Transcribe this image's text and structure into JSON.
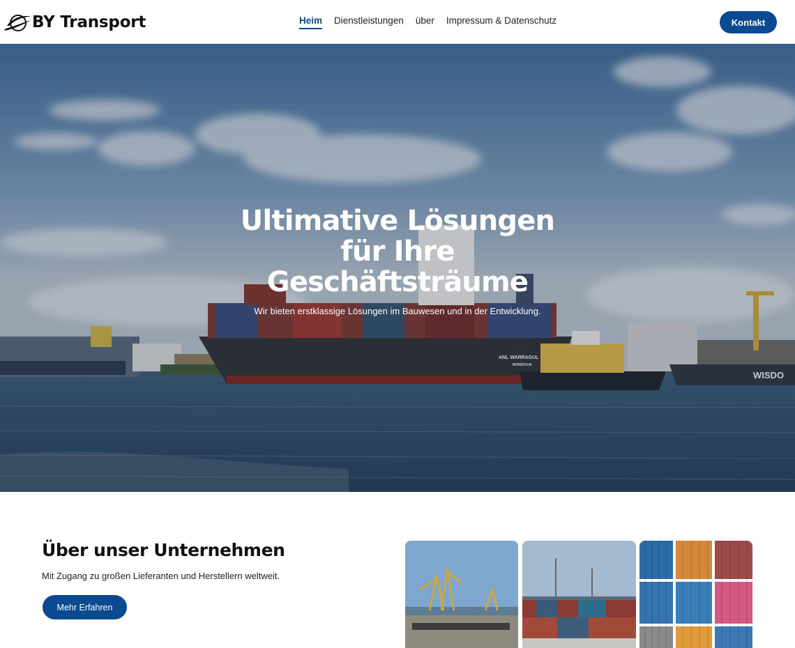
{
  "header": {
    "logo_text": "BY Transport",
    "logo_icon": "swoosh-logo-icon",
    "nav": [
      {
        "label": "Heim",
        "active": true
      },
      {
        "label": "Dienstleistungen",
        "active": false
      },
      {
        "label": "über",
        "active": false
      },
      {
        "label": "Impressum & Datenschutz",
        "active": false
      }
    ],
    "contact_label": "Kontakt"
  },
  "hero": {
    "title_lines": [
      "Ultimative Lösungen",
      "für Ihre",
      "Geschäftsträume"
    ],
    "subtitle": "Wir bieten erstklassige Lösungen im Bauwesen und in der Entwicklung.",
    "ship_name": "ANL WARRAGUL",
    "ship_port": "MONROVIA",
    "right_ship_name": "WISDO"
  },
  "about": {
    "title": "Über unser Unternehmen",
    "text": "Mit Zugang zu großen Lieferanten und Herstellern weltweit.",
    "button_label": "Mehr Erfahren"
  },
  "colors": {
    "primary": "#0a4a91",
    "active_nav": "#0b4a8f"
  }
}
